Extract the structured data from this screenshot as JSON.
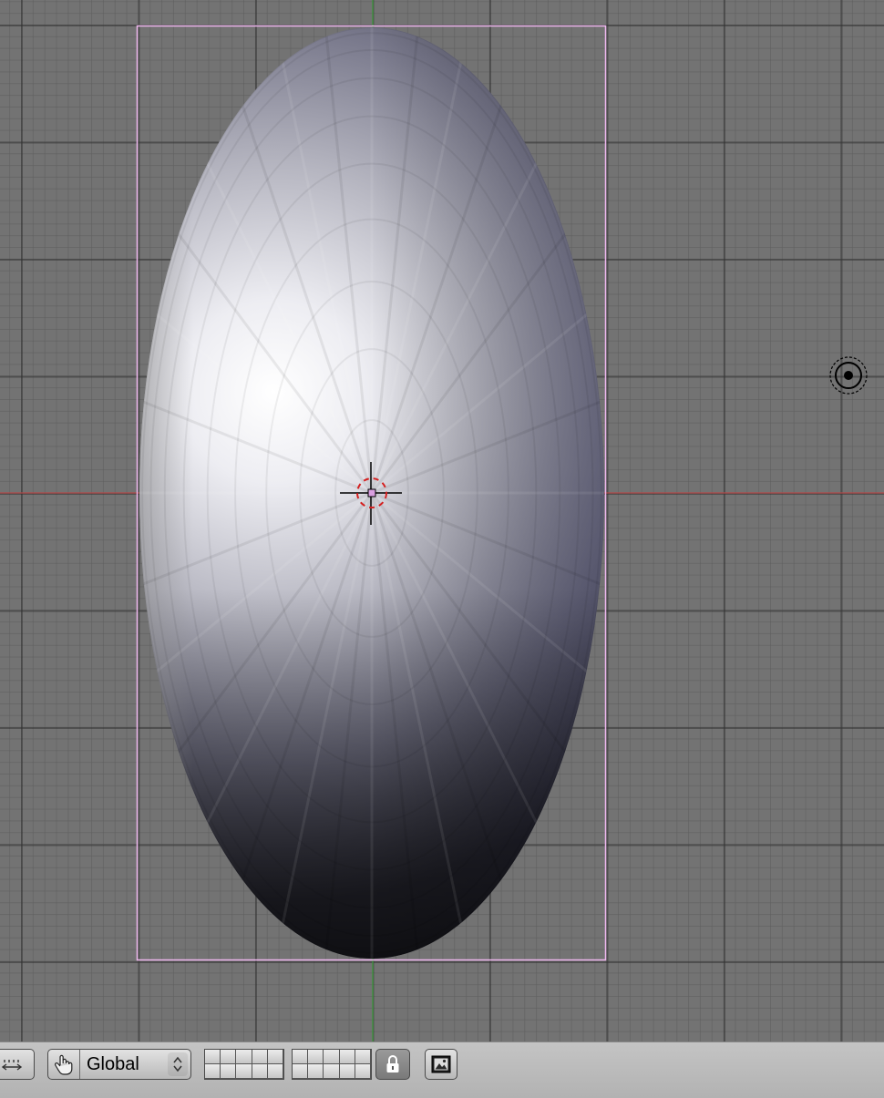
{
  "viewport": {
    "background_color": "#737373",
    "grid_minor_color": "#5f5f5f",
    "grid_major_color": "#323232",
    "x_axis_color": "#b04848",
    "y_axis_color": "#3a9a3a",
    "selection_outline_color": "#f0b8f0"
  },
  "object": {
    "type": "ellipsoid-mesh",
    "state": "selected"
  },
  "cursor_3d": {
    "icon": "crosshair-icon"
  },
  "lamp": {
    "icon": "lamp-icon"
  },
  "header": {
    "view_options_icon": "view-options-icon",
    "orientation_icon": "hand-icon",
    "orientation_value": "Global",
    "layer_lock_icon": "lock-icon",
    "render_icon": "render-icon"
  }
}
